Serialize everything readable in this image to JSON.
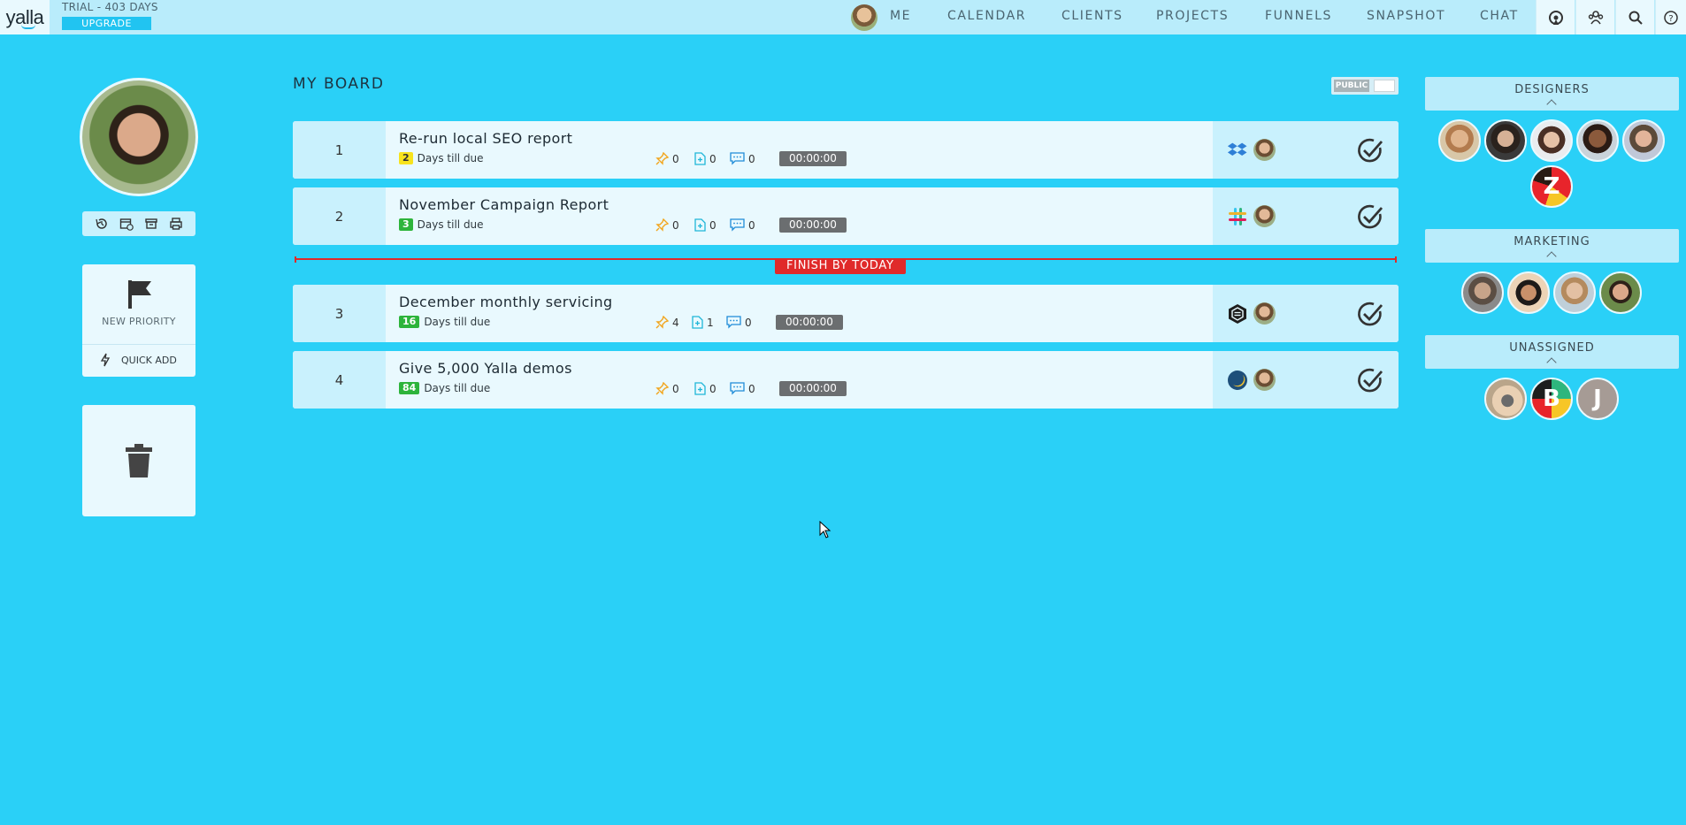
{
  "topbar": {
    "logo": "yalla",
    "trial": "TRIAL - 403 DAYS",
    "upgrade": "UPGRADE",
    "nav": [
      "ME",
      "CALENDAR",
      "CLIENTS",
      "PROJECTS",
      "FUNNELS",
      "SNAPSHOT",
      "CHAT"
    ],
    "icons": [
      "support-icon",
      "team-icon",
      "search-icon",
      "help-icon"
    ]
  },
  "sidebar": {
    "tools": [
      "history-icon",
      "calendar-clock-icon",
      "archive-icon",
      "print-icon"
    ],
    "new_priority": "NEW PRIORITY",
    "quick_add": "QUICK ADD"
  },
  "board": {
    "title": "MY BOARD",
    "visibility": "PUBLIC",
    "finish_label": "FINISH BY TODAY",
    "tasks": [
      {
        "num": "1",
        "name": "Re-run local SEO report",
        "days": "2",
        "due_text": "Days till due",
        "badge": "yellow",
        "pins": "0",
        "files": "0",
        "comments": "0",
        "timer": "00:00:00",
        "service": "dropbox"
      },
      {
        "num": "2",
        "name": "November Campaign Report",
        "days": "3",
        "due_text": "Days till due",
        "badge": "green",
        "pins": "0",
        "files": "0",
        "comments": "0",
        "timer": "00:00:00",
        "service": "slack"
      },
      {
        "num": "3",
        "name": "December monthly servicing",
        "days": "16",
        "due_text": "Days till due",
        "badge": "green",
        "pins": "4",
        "files": "1",
        "comments": "0",
        "timer": "00:00:00",
        "service": "badge-logo"
      },
      {
        "num": "4",
        "name": "Give 5,000 Yalla demos",
        "days": "84",
        "due_text": "Days till due",
        "badge": "green",
        "pins": "0",
        "files": "0",
        "comments": "0",
        "timer": "00:00:00",
        "service": "moon-logo"
      }
    ]
  },
  "groups": [
    {
      "name": "DESIGNERS",
      "members": 6,
      "letter_avatar": "Z"
    },
    {
      "name": "MARKETING",
      "members": 4
    },
    {
      "name": "UNASSIGNED",
      "members": 3,
      "letter_avatars": [
        "B",
        "J"
      ]
    }
  ],
  "colors": {
    "background": "#2ad0f7",
    "card": "#e9f9fe",
    "card_accent": "#c9f1fd",
    "finish_red": "#e02a2a",
    "badge_yellow": "#f7e31d",
    "badge_green": "#2db43b",
    "timer_gray": "#6b6e70"
  }
}
